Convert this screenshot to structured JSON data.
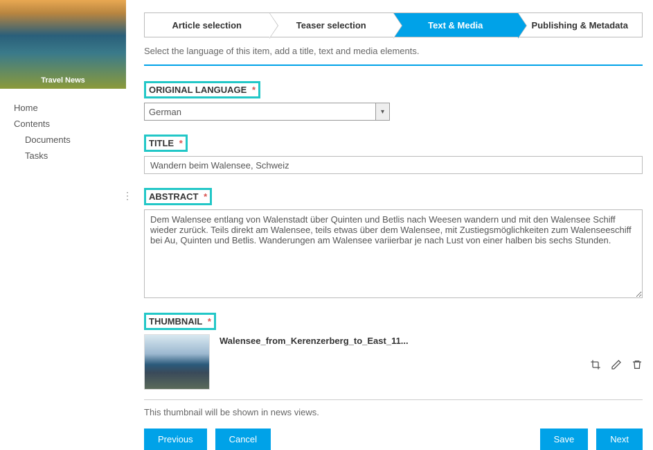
{
  "sidebar": {
    "header_title": "Travel News",
    "items": [
      {
        "label": "Home",
        "indent": false
      },
      {
        "label": "Contents",
        "indent": false
      },
      {
        "label": "Documents",
        "indent": true
      },
      {
        "label": "Tasks",
        "indent": true
      }
    ]
  },
  "wizard": {
    "steps": [
      {
        "label": "Article selection",
        "active": false
      },
      {
        "label": "Teaser selection",
        "active": false
      },
      {
        "label": "Text & Media",
        "active": true
      },
      {
        "label": "Publishing & Metadata",
        "active": false
      }
    ]
  },
  "instruction": "Select the language of this item, add a title, text and media elements.",
  "labels": {
    "original_language": "ORIGINAL LANGUAGE",
    "title": "TITLE",
    "abstract": "ABSTRACT",
    "thumbnail": "THUMBNAIL",
    "required": "*"
  },
  "form": {
    "language_value": "German",
    "language_options": [
      "German"
    ],
    "title_value": "Wandern beim Walensee, Schweiz",
    "abstract_value": "Dem Walensee entlang von Walenstadt über Quinten und Betlis nach Weesen wandern und mit den Walensee Schiff wieder zurück. Teils direkt am Walensee, teils etwas über dem Walensee, mit Zustiegsmöglichkeiten zum Walenseeschiff bei Au, Quinten und Betlis. Wanderungen am Walensee variierbar je nach Lust von einer halben bis sechs Stunden."
  },
  "thumbnail": {
    "filename": "Walensee_from_Kerenzerberg_to_East_11...",
    "note": "This thumbnail will be shown in news views."
  },
  "buttons": {
    "previous": "Previous",
    "cancel": "Cancel",
    "save": "Save",
    "next": "Next"
  }
}
